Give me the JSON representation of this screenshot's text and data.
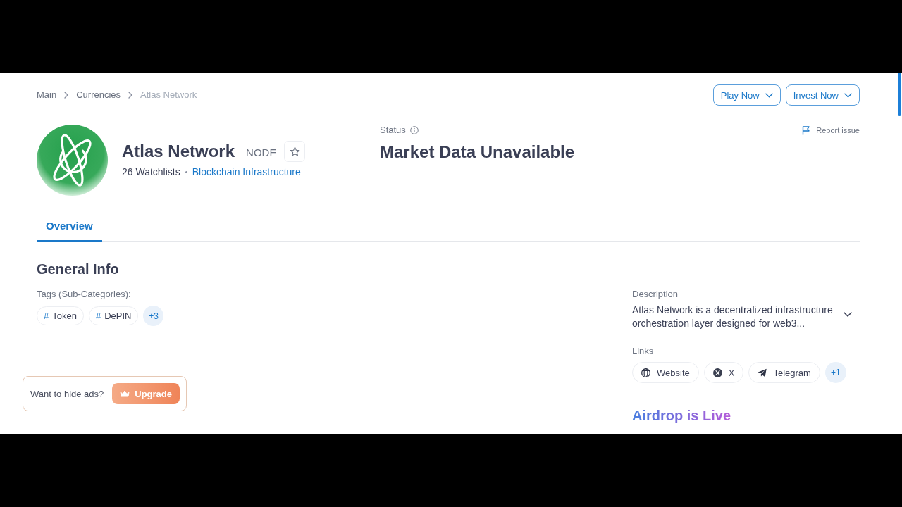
{
  "breadcrumb": [
    {
      "label": "Main",
      "current": false
    },
    {
      "label": "Currencies",
      "current": false
    },
    {
      "label": "Atlas Network",
      "current": true
    }
  ],
  "header_buttons": [
    {
      "label": "Play Now"
    },
    {
      "label": "Invest Now"
    }
  ],
  "coin": {
    "name": "Atlas Network",
    "ticker": "NODE",
    "starred": false,
    "watchlists": "26 Watchlists",
    "category": "Blockchain Infrastructure"
  },
  "status": {
    "label": "Status",
    "value": "Market Data Unavailable"
  },
  "report_issue": "Report issue",
  "tabs": [
    {
      "label": "Overview",
      "selected": true
    }
  ],
  "general_info": {
    "title": "General Info",
    "tags_label": "Tags (Sub-Categories):",
    "tags": [
      {
        "symbol": "#",
        "label": "Token"
      },
      {
        "symbol": "#",
        "label": "DePIN"
      }
    ],
    "more_tags": "+3"
  },
  "description": {
    "label": "Description",
    "text": "Atlas Network is a decentralized infrastructure orchestration layer designed for web3...",
    "expanded": false
  },
  "links": {
    "label": "Links",
    "items": [
      {
        "kind": "globe",
        "label": "Website"
      },
      {
        "kind": "x",
        "label": "X"
      },
      {
        "kind": "telegram",
        "label": "Telegram"
      }
    ],
    "more": "+1"
  },
  "airdrop": {
    "title": "Airdrop is Live"
  },
  "ad_banner": {
    "text": "Want to hide ads?",
    "button": "Upgrade"
  }
}
